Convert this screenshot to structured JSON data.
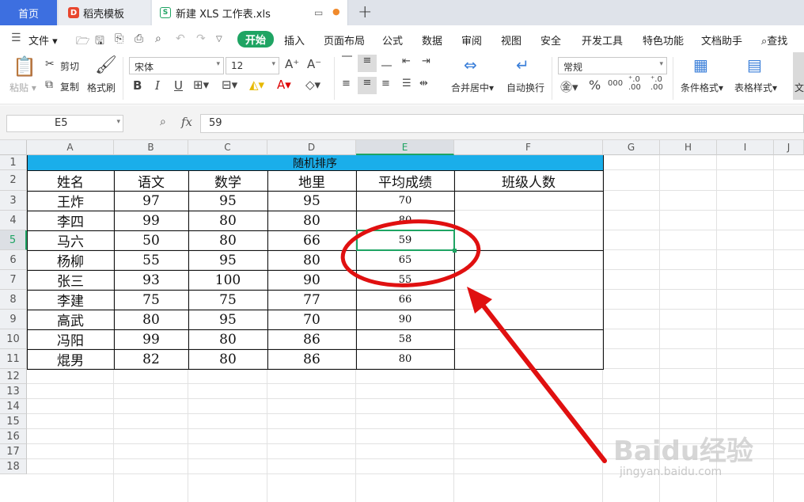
{
  "tabs": {
    "home": "首页",
    "template": "稻壳模板",
    "file": "新建 XLS 工作表.xls",
    "template_icon_glyph": "D",
    "file_icon_glyph": "S"
  },
  "menu": {
    "file": "文件",
    "start": "开始",
    "insert": "插入",
    "page_layout": "页面布局",
    "formula": "公式",
    "data": "数据",
    "review": "审阅",
    "view": "视图",
    "security": "安全",
    "dev_tools": "开发工具",
    "special": "特色功能",
    "doc_helper": "文档助手",
    "search": "查找"
  },
  "ribbon": {
    "paste": "粘贴",
    "cut": "剪切",
    "copy": "复制",
    "format_painter": "格式刷",
    "font_name": "宋体",
    "font_size": "12",
    "merge_center": "合并居中",
    "wrap_text": "自动换行",
    "number_format": "常规",
    "conditional_format": "条件格式",
    "table_style": "表格样式",
    "bold": "B",
    "italic": "I",
    "underline": "U",
    "grow_font": "A⁺",
    "shrink_font": "A⁻",
    "percent": "%",
    "thousands": "000",
    "inc_decimal": "⁺.0 .00",
    "dec_decimal": "⁺.0 .00",
    "cutoff_label": "文"
  },
  "formula_bar": {
    "cell_ref": "E5",
    "fx": "fx",
    "value": "59"
  },
  "columns": [
    "A",
    "B",
    "C",
    "D",
    "E",
    "F",
    "G",
    "H",
    "I",
    "J"
  ],
  "rows": [
    "1",
    "2",
    "3",
    "4",
    "5",
    "6",
    "7",
    "8",
    "9",
    "10",
    "11",
    "12",
    "13",
    "14",
    "15",
    "16",
    "17",
    "18"
  ],
  "sheet": {
    "title": "随机排序",
    "headers": [
      "姓名",
      "语文",
      "数学",
      "地里",
      "平均成绩",
      "班级人数"
    ],
    "records": [
      [
        "王炸",
        "97",
        "95",
        "95",
        "70"
      ],
      [
        "李四",
        "99",
        "80",
        "80",
        "80"
      ],
      [
        "马六",
        "50",
        "80",
        "66",
        "59"
      ],
      [
        "杨柳",
        "55",
        "95",
        "80",
        "65"
      ],
      [
        "张三",
        "93",
        "100",
        "90",
        "55"
      ],
      [
        "李建",
        "75",
        "75",
        "77",
        "66"
      ],
      [
        "高武",
        "80",
        "95",
        "70",
        "90"
      ],
      [
        "冯阳",
        "99",
        "80",
        "86",
        "58"
      ],
      [
        "焜男",
        "82",
        "80",
        "86",
        "80"
      ]
    ]
  },
  "colors": {
    "title_fill": "#1aaeea",
    "accent_green": "#1fa463",
    "annotation_red": "#e01010",
    "home_tab": "#3d6fe0"
  },
  "watermark": {
    "text": "Baidu经验",
    "url": "jingyan.baidu.com"
  }
}
